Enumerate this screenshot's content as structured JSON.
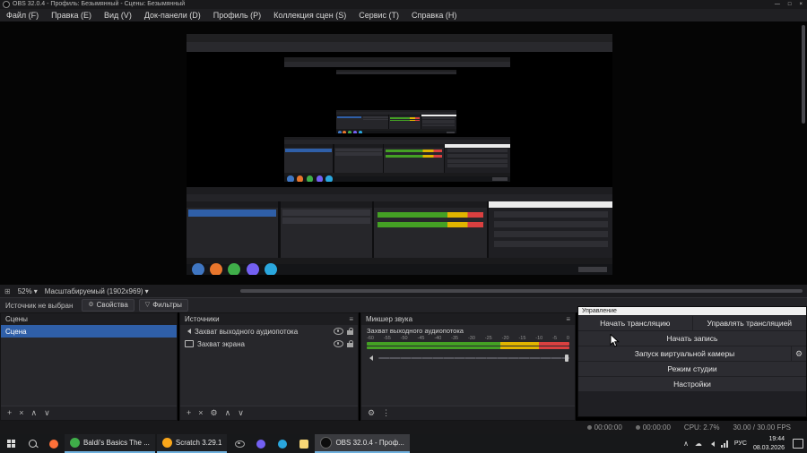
{
  "titlebar": {
    "title": "OBS 32.0.4 - Профиль: Безымянный - Сцены: Безымянный"
  },
  "icons": {
    "minimize": "—",
    "maximize": "□",
    "close": "×",
    "grip": "⊞",
    "caret_down": "▾",
    "dock_menu": "≡",
    "add": "+",
    "remove": "×",
    "gear": "⚙",
    "up": "∧",
    "down": "∨",
    "dots": "⋮",
    "filter": "▽",
    "tray_caret": "∧",
    "cloud": "☁"
  },
  "menu": {
    "items": [
      "Файл (F)",
      "Правка (E)",
      "Вид (V)",
      "Док-панели (D)",
      "Профиль (P)",
      "Коллекция сцен (S)",
      "Сервис (T)",
      "Справка (H)"
    ]
  },
  "preview_toolbar": {
    "zoom": "52%",
    "scale_mode": "Масштабируемый (1902x969)"
  },
  "source_row": {
    "status": "Источник не выбран",
    "properties_label": "Свойства",
    "filters_label": "Фильтры"
  },
  "scenes_dock": {
    "title": "Сцены",
    "items": [
      {
        "name": "Сцена"
      }
    ]
  },
  "sources_dock": {
    "title": "Источники",
    "items": [
      {
        "name": "Захват выходного аудиопотока",
        "icon": "speaker-icon"
      },
      {
        "name": "Захват экрана",
        "icon": "display-icon"
      }
    ]
  },
  "mixer_dock": {
    "title": "Микшер звука",
    "channel_name": "Захват выходного аудиопотока",
    "db_scale": [
      "-60",
      "-55",
      "-50",
      "-45",
      "-40",
      "-35",
      "-30",
      "-25",
      "-20",
      "-15",
      "-10",
      "-5",
      "0"
    ]
  },
  "controls_dock": {
    "title": "Управление",
    "start_stream": "Начать трансляцию",
    "manage_stream": "Управлять трансляцией",
    "start_record": "Начать запись",
    "virtual_cam": "Запуск виртуальной камеры",
    "studio_mode": "Режим студии",
    "settings": "Настройки"
  },
  "status_bar": {
    "rec_time": "00:00:00",
    "stream_time": "00:00:00",
    "cpu": "CPU: 2.7%",
    "fps": "30.00 / 30.00 FPS"
  },
  "taskbar": {
    "tasks": [
      {
        "label": "Baldi's Basics The ..."
      },
      {
        "label": "Scratch 3.29.1"
      },
      {
        "label": "OBS 32.0.4 - Проф..."
      }
    ],
    "lang": "РУС",
    "time": "19:44",
    "date": "08.03.2026"
  },
  "colors": {
    "accent_blue": "#2f5fa8",
    "meter_green": "#44a024",
    "meter_yellow": "#e0b400",
    "meter_red": "#d94040",
    "taskbar_underline": "#6fb0dd"
  }
}
